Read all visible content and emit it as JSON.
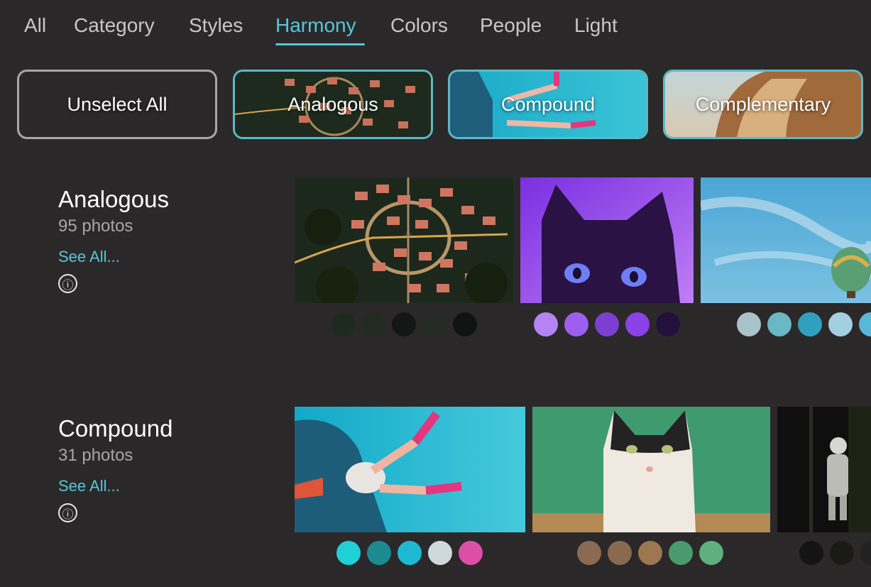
{
  "tabs": [
    "All",
    "Category",
    "Styles",
    "Harmony",
    "Colors",
    "People",
    "Light"
  ],
  "active_tab": "Harmony",
  "chips": {
    "unselect": "Unselect All",
    "analogous": "Analogous",
    "compound": "Compound",
    "complementary": "Complementary"
  },
  "sections": [
    {
      "title": "Analogous",
      "count": "95 photos",
      "see_all": "See All...",
      "info_icon": "ⓘ",
      "palettes": [
        [
          "#1e2a1f",
          "#222b22",
          "#141715",
          "#252c27",
          "#111312"
        ],
        [
          "#b583f4",
          "#9e5ff0",
          "#7d3ed3",
          "#8a41e6",
          "#24103c"
        ],
        [
          "#a8c3c9",
          "#6ab7c6",
          "#2fa1bf",
          "#a3cfe0",
          "#58b8d8"
        ]
      ]
    },
    {
      "title": "Compound",
      "count": "31 photos",
      "see_all": "See All...",
      "info_icon": "ⓘ",
      "palettes": [
        [
          "#1fd0d6",
          "#1b8b91",
          "#1fb8d3",
          "#cfd8dc",
          "#dd4fa7"
        ],
        [
          "#8b6a53",
          "#8a6a4f",
          "#9c7751",
          "#4b9a6e",
          "#5fb07f"
        ],
        [
          "#141414",
          "#1b1b16",
          "#222222"
        ]
      ]
    }
  ]
}
